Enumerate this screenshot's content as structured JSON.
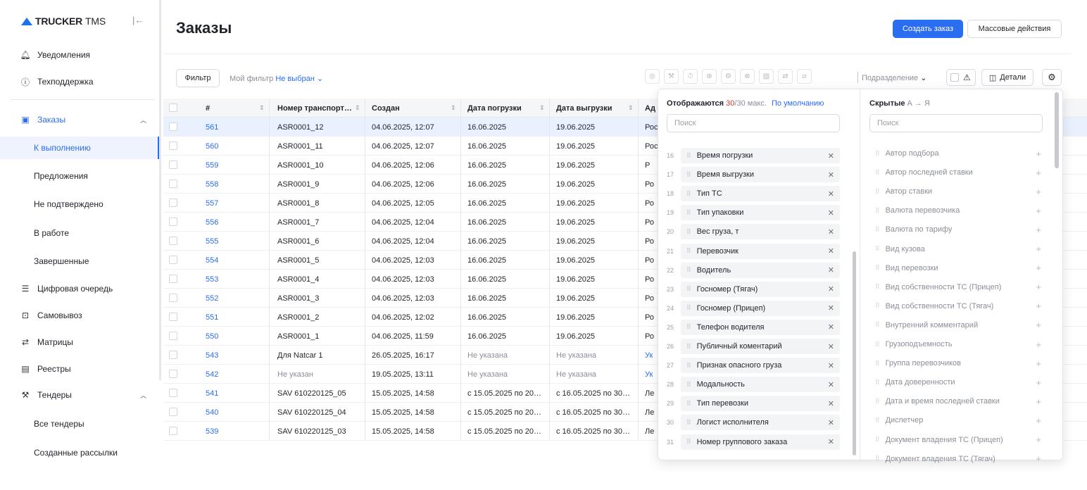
{
  "sidebar": {
    "logo_bold": "TRUCKER",
    "logo_thin": "TMS",
    "items": [
      {
        "label": "Уведомления",
        "icon": "bell-icon"
      },
      {
        "label": "Техподдержка",
        "icon": "help-icon"
      },
      {
        "label": "Заказы",
        "icon": "calendar-icon"
      },
      {
        "label": "К выполнению"
      },
      {
        "label": "Предложения"
      },
      {
        "label": "Не подтверждено"
      },
      {
        "label": "В работе"
      },
      {
        "label": "Завершенные"
      },
      {
        "label": "Цифровая очередь",
        "icon": "queue-icon"
      },
      {
        "label": "Самовывоз",
        "icon": "pickup-icon"
      },
      {
        "label": "Матрицы",
        "icon": "swap-icon"
      },
      {
        "label": "Реестры",
        "icon": "registry-icon"
      },
      {
        "label": "Тендеры",
        "icon": "hammer-icon"
      },
      {
        "label": "Все тендеры"
      },
      {
        "label": "Созданные рассылки"
      }
    ]
  },
  "header": {
    "title": "Заказы",
    "create_label": "Создать заказ",
    "bulk_label": "Массовые действия"
  },
  "toolbar": {
    "filter_label": "Фильтр",
    "my_filter_label": "Мой фильтр",
    "my_filter_value": "Не выбран",
    "department_label": "Подразделение",
    "details_label": "Детали"
  },
  "table": {
    "columns": [
      "#",
      "Номер транспорт…",
      "Создан",
      "Дата погрузки",
      "Дата выгрузки",
      "Ад"
    ],
    "rows": [
      {
        "num": "561",
        "transport": "ASR0001_12",
        "created": "04.06.2025, 12:07",
        "load": "16.06.2025",
        "unload": "19.06.2025",
        "addr": "Рос"
      },
      {
        "num": "560",
        "transport": "ASR0001_11",
        "created": "04.06.2025, 12:07",
        "load": "16.06.2025",
        "unload": "19.06.2025",
        "addr": "Рос"
      },
      {
        "num": "559",
        "transport": "ASR0001_10",
        "created": "04.06.2025, 12:06",
        "load": "16.06.2025",
        "unload": "19.06.2025",
        "addr": "Р"
      },
      {
        "num": "558",
        "transport": "ASR0001_9",
        "created": "04.06.2025, 12:06",
        "load": "16.06.2025",
        "unload": "19.06.2025",
        "addr": "Ро"
      },
      {
        "num": "557",
        "transport": "ASR0001_8",
        "created": "04.06.2025, 12:05",
        "load": "16.06.2025",
        "unload": "19.06.2025",
        "addr": "Ро"
      },
      {
        "num": "556",
        "transport": "ASR0001_7",
        "created": "04.06.2025, 12:04",
        "load": "16.06.2025",
        "unload": "19.06.2025",
        "addr": "Ро"
      },
      {
        "num": "555",
        "transport": "ASR0001_6",
        "created": "04.06.2025, 12:04",
        "load": "16.06.2025",
        "unload": "19.06.2025",
        "addr": "Ро"
      },
      {
        "num": "554",
        "transport": "ASR0001_5",
        "created": "04.06.2025, 12:03",
        "load": "16.06.2025",
        "unload": "19.06.2025",
        "addr": "Ро"
      },
      {
        "num": "553",
        "transport": "ASR0001_4",
        "created": "04.06.2025, 12:03",
        "load": "16.06.2025",
        "unload": "19.06.2025",
        "addr": "Ро"
      },
      {
        "num": "552",
        "transport": "ASR0001_3",
        "created": "04.06.2025, 12:03",
        "load": "16.06.2025",
        "unload": "19.06.2025",
        "addr": "Ро"
      },
      {
        "num": "551",
        "transport": "ASR0001_2",
        "created": "04.06.2025, 12:02",
        "load": "16.06.2025",
        "unload": "19.06.2025",
        "addr": "Ро"
      },
      {
        "num": "550",
        "transport": "ASR0001_1",
        "created": "04.06.2025, 11:59",
        "load": "16.06.2025",
        "unload": "19.06.2025",
        "addr": "Ро"
      },
      {
        "num": "543",
        "transport": "Для Natcar 1",
        "created": "26.05.2025, 16:17",
        "load": "Не указана",
        "unload": "Не указана",
        "addr": "Ук"
      },
      {
        "num": "542",
        "transport": "Не указан",
        "created": "19.05.2025, 13:11",
        "load": "Не указана",
        "unload": "Не указана",
        "addr": "Ук"
      },
      {
        "num": "541",
        "transport": "SAV 610220125_05",
        "created": "15.05.2025, 14:58",
        "load": "с 15.05.2025 по 20…",
        "unload": "с 16.05.2025 по 30…",
        "addr": "Ле"
      },
      {
        "num": "540",
        "transport": "SAV 610220125_04",
        "created": "15.05.2025, 14:58",
        "load": "с 15.05.2025 по 20…",
        "unload": "с 16.05.2025 по 30…",
        "addr": "Ле"
      },
      {
        "num": "539",
        "transport": "SAV 610220125_03",
        "created": "15.05.2025, 14:58",
        "load": "с 15.05.2025 по 20…",
        "unload": "с 16.05.2025 по 30…",
        "addr": "Ле"
      }
    ]
  },
  "columns_panel": {
    "visible_label": "Отображаются",
    "visible_count": "30",
    "visible_max": "/30 макс.",
    "default_label": "По умолчанию",
    "hidden_label": "Скрытые",
    "hidden_sort": "А → Я",
    "search_placeholder": "Поиск",
    "visible_items": [
      {
        "n": "16",
        "label": "Время погрузки"
      },
      {
        "n": "17",
        "label": "Время выгрузки"
      },
      {
        "n": "18",
        "label": "Тип ТС"
      },
      {
        "n": "19",
        "label": "Тип упаковки"
      },
      {
        "n": "20",
        "label": "Вес груза, т"
      },
      {
        "n": "21",
        "label": "Перевозчик"
      },
      {
        "n": "22",
        "label": "Водитель"
      },
      {
        "n": "23",
        "label": "Госномер (Тягач)"
      },
      {
        "n": "24",
        "label": "Госномер (Прицеп)"
      },
      {
        "n": "25",
        "label": "Телефон водителя"
      },
      {
        "n": "26",
        "label": "Публичный коментарий"
      },
      {
        "n": "27",
        "label": "Признак опасного груза"
      },
      {
        "n": "28",
        "label": "Модальность"
      },
      {
        "n": "29",
        "label": "Тип перевозки"
      },
      {
        "n": "30",
        "label": "Логист исполнителя"
      },
      {
        "n": "31",
        "label": "Номер группового заказа"
      }
    ],
    "hidden_items": [
      "Автор подбора",
      "Автор последней ставки",
      "Автор ставки",
      "Валюта перевозчика",
      "Валюта по тарифу",
      "Вид кузова",
      "Вид перевозки",
      "Вид собственности ТС (Прицеп)",
      "Вид собственности ТС (Тягач)",
      "Внутренний комментарий",
      "Грузоподъемность",
      "Группа перевозчиков",
      "Дата доверенности",
      "Дата и время последней ставки",
      "Диспетчер",
      "Документ владения ТС (Прицеп)",
      "Документ владения ТС (Тягач)"
    ]
  },
  "colors": {
    "accent": "#2b6df0",
    "annotation_arrow": "#d0392b"
  }
}
